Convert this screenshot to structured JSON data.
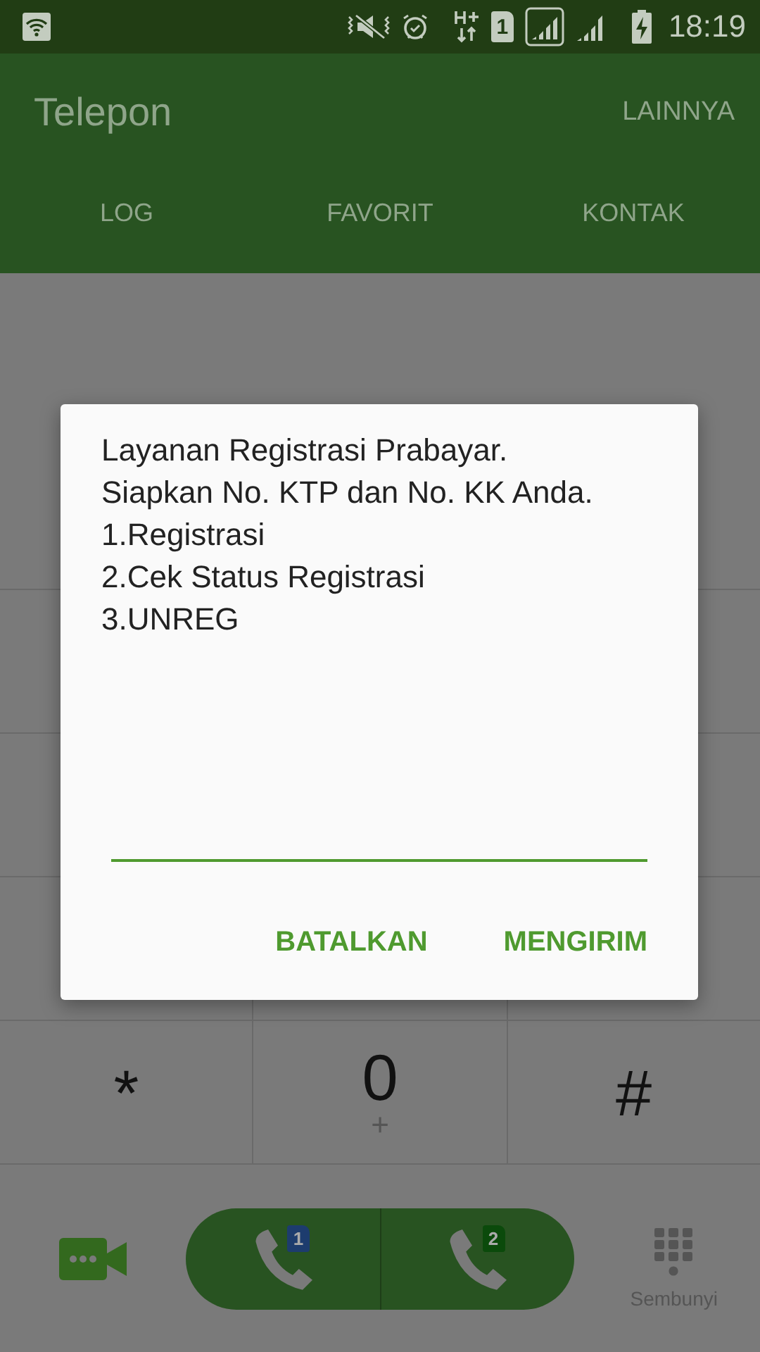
{
  "status_bar": {
    "sim_number": "1",
    "time": "18:19"
  },
  "app_bar": {
    "title": "Telepon",
    "menu": "LAINNYA"
  },
  "tabs": [
    {
      "label": "LOG",
      "selected": false
    },
    {
      "label": "FAVORIT",
      "selected": false
    },
    {
      "label": "KONTAK",
      "selected": false
    }
  ],
  "keypad": [
    {
      "main": "*"
    },
    {
      "main": "0",
      "sub": "+"
    },
    {
      "main": "#"
    }
  ],
  "dialog": {
    "message_lines": [
      "Layanan Registrasi Prabayar.",
      "Siapkan No. KTP dan No. KK Anda.",
      "1.Registrasi",
      "2.Cek Status Registrasi",
      "3.UNREG"
    ],
    "buttons": [
      "BATALKAN",
      "MENGIRIM"
    ]
  },
  "call_buttons": [
    {
      "sim": "1",
      "color": "#1d3c6e"
    },
    {
      "sim": "2",
      "color": "#0b4a0b"
    }
  ],
  "hide_label": "Sembunyi"
}
